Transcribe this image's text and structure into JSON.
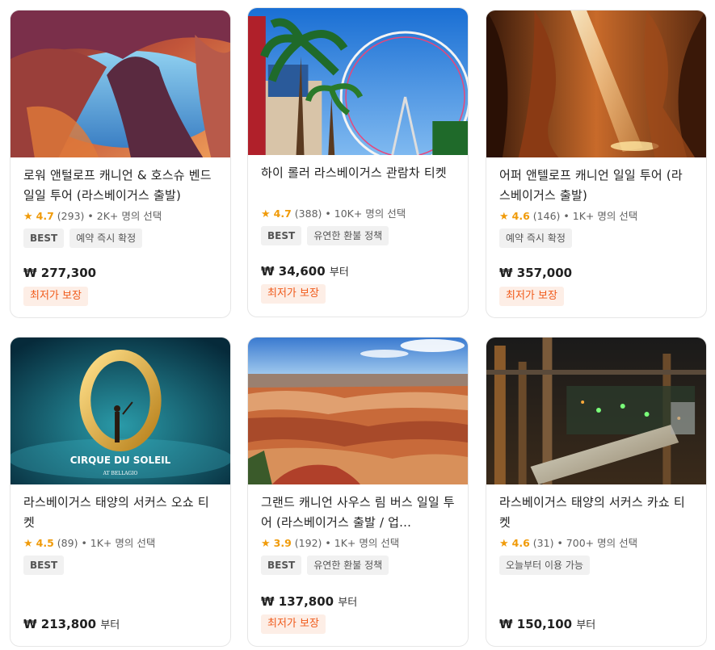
{
  "cards": [
    {
      "title": "로워 앤털로프 캐니언 & 호스슈 벤드 일일 투어 (라스베이거스 출발)",
      "rating": "4.7",
      "reviews": "(293)",
      "selected": "• 2K+ 명의 선택",
      "tags": [
        "BEST",
        "예약 즉시 확정"
      ],
      "price": "₩ 277,300",
      "price_suffix": "",
      "promo": "최저가 보장"
    },
    {
      "title": "하이 롤러 라스베이거스 관람차 티켓",
      "rating": "4.7",
      "reviews": "(388)",
      "selected": "• 10K+ 명의 선택",
      "tags": [
        "BEST",
        "유연한 환불 정책"
      ],
      "price": "₩ 34,600",
      "price_suffix": "부터",
      "promo": "최저가 보장"
    },
    {
      "title": "어퍼 앤텔로프 캐니언 일일 투어 (라스베이거스 출발)",
      "rating": "4.6",
      "reviews": "(146)",
      "selected": "• 1K+ 명의 선택",
      "tags": [
        "예약 즉시 확정"
      ],
      "price": "₩ 357,000",
      "price_suffix": "",
      "promo": "최저가 보장"
    },
    {
      "title": "라스베이거스 태양의 서커스 오쇼 티켓",
      "rating": "4.5",
      "reviews": "(89)",
      "selected": "• 1K+ 명의 선택",
      "tags": [
        "BEST"
      ],
      "price": "₩ 213,800",
      "price_suffix": "부터",
      "promo": ""
    },
    {
      "title": "그랜드 캐니언 사우스 림 버스 일일 투어 (라스베이거스 출발 / 업...",
      "rating": "3.9",
      "reviews": "(192)",
      "selected": "• 1K+ 명의 선택",
      "tags": [
        "BEST",
        "유연한 환불 정책"
      ],
      "price": "₩ 137,800",
      "price_suffix": "부터",
      "promo": "최저가 보장"
    },
    {
      "title": "라스베이거스 태양의 서커스 카쇼 티켓",
      "rating": "4.6",
      "reviews": "(31)",
      "selected": "• 700+ 명의 선택",
      "tags": [
        "오늘부터 이용 가능"
      ],
      "price": "₩ 150,100",
      "price_suffix": "부터",
      "promo": ""
    }
  ],
  "image_text": {
    "o_show_name": "CIRQUE DU SOLEIL",
    "o_show_venue": "AT BELLAGIO"
  },
  "colors": {
    "star": "#f09b0a",
    "promo_bg": "#fdeee6",
    "promo_text": "#f05a1a",
    "tag_bg": "#f1f1f1"
  }
}
